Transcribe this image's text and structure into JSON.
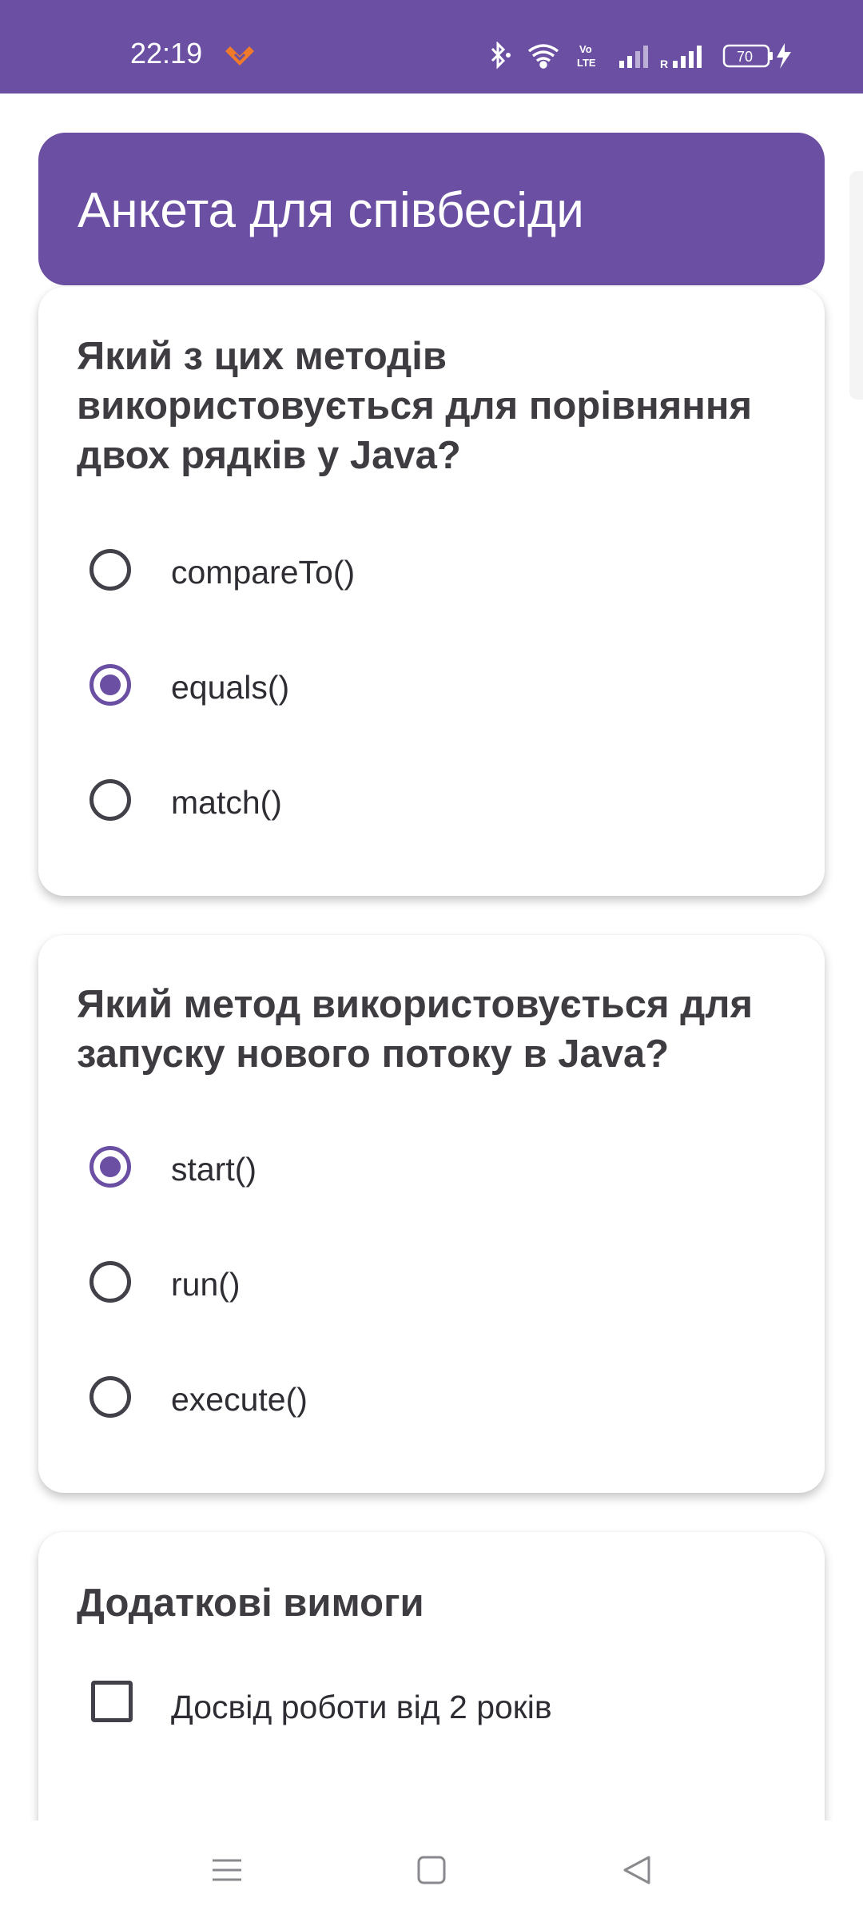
{
  "status_bar": {
    "time": "22:19",
    "battery": "70",
    "icons": [
      "heart-icon",
      "bluetooth-icon",
      "wifi-icon",
      "volte-icon",
      "signal-icon",
      "signal-roaming-icon",
      "battery-icon",
      "charging-icon"
    ]
  },
  "header": {
    "title": "Анкета для співбесіди"
  },
  "question1": {
    "title": "Який з цих методів використовується для порівняння двох рядків у Java?",
    "options": [
      {
        "label": "compareTo()",
        "selected": false
      },
      {
        "label": "equals()",
        "selected": true
      },
      {
        "label": "match()",
        "selected": false
      }
    ]
  },
  "question2": {
    "title": "Який метод використовується для запуску нового потоку в Java?",
    "options": [
      {
        "label": "start()",
        "selected": true
      },
      {
        "label": "run()",
        "selected": false
      },
      {
        "label": "execute()",
        "selected": false
      }
    ]
  },
  "requirements": {
    "title": "Додаткові вимоги",
    "items": [
      {
        "label": "Досвід роботи від 2 років",
        "checked": false
      }
    ]
  },
  "navigation": {
    "buttons": [
      "menu-icon",
      "home-icon",
      "back-icon"
    ]
  },
  "colors": {
    "accent": "#6a4fa3",
    "text": "#3e3c41",
    "background": "#ffffff"
  }
}
